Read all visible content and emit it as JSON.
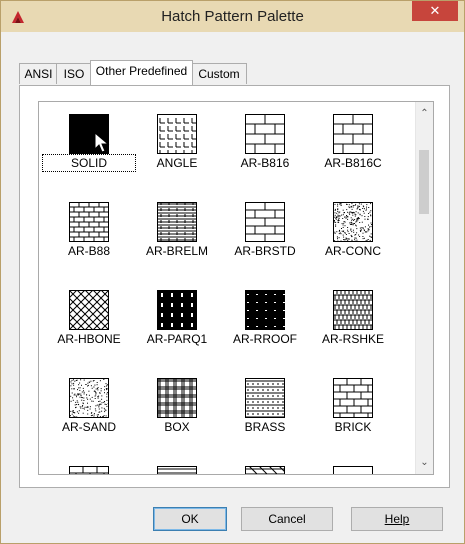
{
  "window": {
    "title": "Hatch Pattern Palette",
    "close_glyph": "✕",
    "app_icon": "autocad-logo-icon"
  },
  "tabs": [
    {
      "label": "ANSI",
      "active": false
    },
    {
      "label": "ISO",
      "active": false
    },
    {
      "label": "Other Predefined",
      "active": true
    },
    {
      "label": "Custom",
      "active": false
    }
  ],
  "patterns": [
    {
      "label": "SOLID",
      "pattern": "solid",
      "focused": true
    },
    {
      "label": "ANGLE",
      "pattern": "angle"
    },
    {
      "label": "AR-B816",
      "pattern": "brick-large"
    },
    {
      "label": "AR-B816C",
      "pattern": "brick-large-c"
    },
    {
      "label": "AR-B88",
      "pattern": "brick-small"
    },
    {
      "label": "AR-BRELM",
      "pattern": "brick-elm"
    },
    {
      "label": "AR-BRSTD",
      "pattern": "brick-std"
    },
    {
      "label": "AR-CONC",
      "pattern": "concrete"
    },
    {
      "label": "AR-HBONE",
      "pattern": "herringbone"
    },
    {
      "label": "AR-PARQ1",
      "pattern": "parquet"
    },
    {
      "label": "AR-RROOF",
      "pattern": "roof"
    },
    {
      "label": "AR-RSHKE",
      "pattern": "shake"
    },
    {
      "label": "AR-SAND",
      "pattern": "sand"
    },
    {
      "label": "BOX",
      "pattern": "box"
    },
    {
      "label": "BRASS",
      "pattern": "brass"
    },
    {
      "label": "BRICK",
      "pattern": "brick"
    },
    {
      "label": "",
      "pattern": "brick-partial"
    },
    {
      "label": "",
      "pattern": "lines-partial"
    },
    {
      "label": "",
      "pattern": "earth-partial"
    },
    {
      "label": "",
      "pattern": "dots-partial"
    }
  ],
  "buttons": {
    "ok": "OK",
    "cancel": "Cancel",
    "help": "Help"
  },
  "colors": {
    "titlebar": "#e8d9b3",
    "close": "#c7453c"
  }
}
